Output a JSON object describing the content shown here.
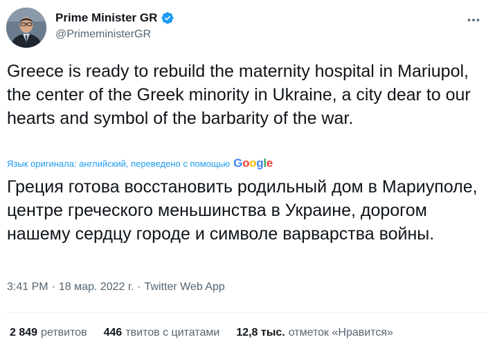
{
  "author": {
    "display_name": "Prime Minister GR",
    "handle": "@PrimeministerGR",
    "verified_icon": "verified-badge-icon",
    "avatar_icon": "profile-photo"
  },
  "tweet": {
    "text": "Greece is ready to rebuild the maternity hospital in Mariupol, the center of the Greek minority in Ukraine, a city dear to our hearts and symbol of the barbarity of the war.",
    "translation_note": "Язык оригинала: английский, переведено с помощью",
    "translation_provider": {
      "letters": [
        "G",
        "o",
        "o",
        "g",
        "l",
        "e"
      ]
    },
    "translated_text": "Греция готова восстановить родильный дом в Мариуполе, центре греческого меньшинства в Украине, дорогом нашему сердцу городе и символе варварства войны."
  },
  "meta": {
    "time": "3:41 PM",
    "separator": "·",
    "date": "18 мар. 2022 г.",
    "source": "Twitter Web App"
  },
  "stats": {
    "retweets_count": "2 849",
    "retweets_label": "ретвитов",
    "quotes_count": "446",
    "quotes_label": "твитов с цитатами",
    "likes_count": "12,8 тыс.",
    "likes_label": "отметок «Нравится»"
  },
  "colors": {
    "accent": "#1d9bf0",
    "text_primary": "#0f1419",
    "text_secondary": "#536471"
  }
}
